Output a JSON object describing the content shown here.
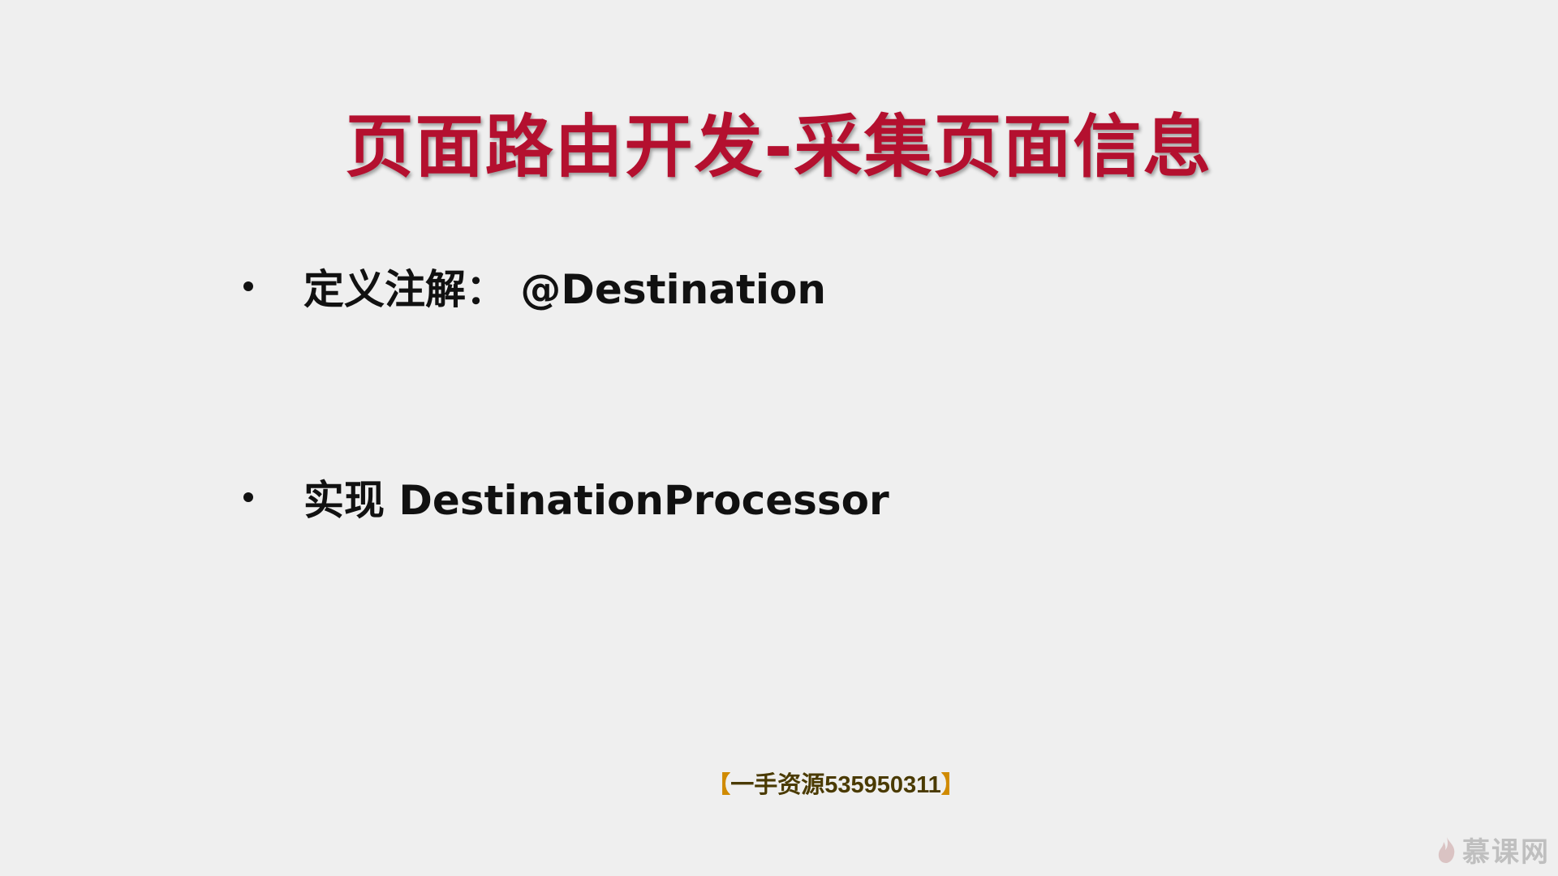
{
  "slide": {
    "title": "页面路由开发-采集页面信息",
    "bullets": [
      {
        "text": "定义注解： @Destination"
      },
      {
        "text": "实现 DestinationProcessor"
      }
    ]
  },
  "watermark": {
    "open_bracket": "【",
    "text": "一手资源535950311",
    "close_bracket": "】"
  },
  "brand": {
    "name": "慕课网",
    "icon": "flame-icon"
  },
  "colors": {
    "title": "#b4102f",
    "background": "#efefef",
    "watermark_bracket": "#d08a00"
  }
}
